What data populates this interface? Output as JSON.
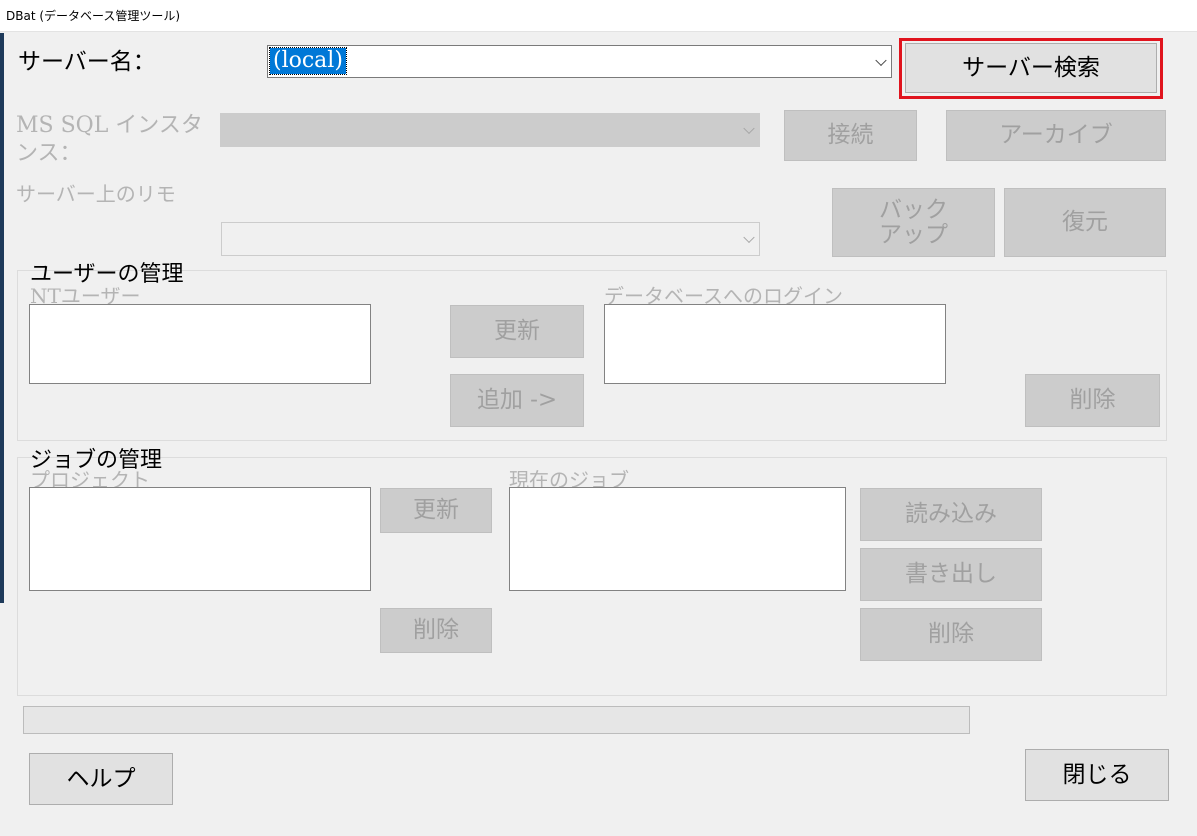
{
  "window": {
    "title": "DBat (データベース管理ツール)"
  },
  "server": {
    "label": "サーバー名：",
    "value": "(local)",
    "search_button": "サーバー検索"
  },
  "instance": {
    "label": "MS SQL インスタンス：",
    "connect_button": "接続",
    "archive_button": "アーカイブ"
  },
  "remote": {
    "label": "サーバー上のリモ",
    "backup_button": "バック アップ",
    "restore_button": "復元"
  },
  "user_mgmt": {
    "title": "ユーザーの管理",
    "nt_users_label": "NTユーザー",
    "db_logins_label": "データベースへのログイン",
    "refresh_button": "更新",
    "add_button": "追加 ->",
    "delete_button": "削除"
  },
  "job_mgmt": {
    "title": "ジョブの管理",
    "projects_label": "プロジェクト",
    "current_jobs_label": "現在のジョブ",
    "refresh_button": "更新",
    "delete_project_button": "削除",
    "import_button": "読み込み",
    "export_button": "書き出し",
    "delete_job_button": "削除"
  },
  "footer": {
    "help_button": "ヘルプ",
    "close_button": "閉じる"
  }
}
